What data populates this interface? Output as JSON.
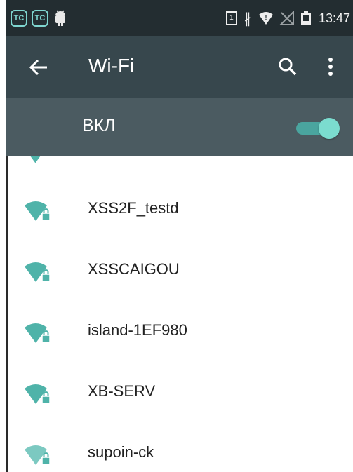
{
  "status_bar": {
    "app_icon_1": "TC",
    "app_icon_2": "TC",
    "sim_label": "1",
    "time": "13:47",
    "icons": [
      "tc-app-icon",
      "tc-app-icon",
      "android-debug-icon",
      "sim-icon",
      "bluetooth-icon",
      "wifi-signal-icon",
      "no-signal-icon",
      "battery-icon"
    ]
  },
  "toolbar": {
    "title": "Wi-Fi",
    "back_icon": "arrow-left",
    "search_icon": "magnifier",
    "more_icon": "vertical-dots"
  },
  "master_switch": {
    "label": "ВКЛ",
    "enabled": true
  },
  "networks": [
    {
      "ssid": "XSS2F_testd",
      "secured": true
    },
    {
      "ssid": "XSSCAIGOU",
      "secured": true
    },
    {
      "ssid": "island-1EF980",
      "secured": true
    },
    {
      "ssid": "XB-SERV",
      "secured": true
    },
    {
      "ssid": "supoin-ck",
      "secured": true
    }
  ],
  "colors": {
    "status_bar": "#232d31",
    "toolbar": "#37474d",
    "switch_row": "#4b5b61",
    "wifi_icon": "#4fb3a9",
    "toggle_on": "#7bdccf"
  }
}
